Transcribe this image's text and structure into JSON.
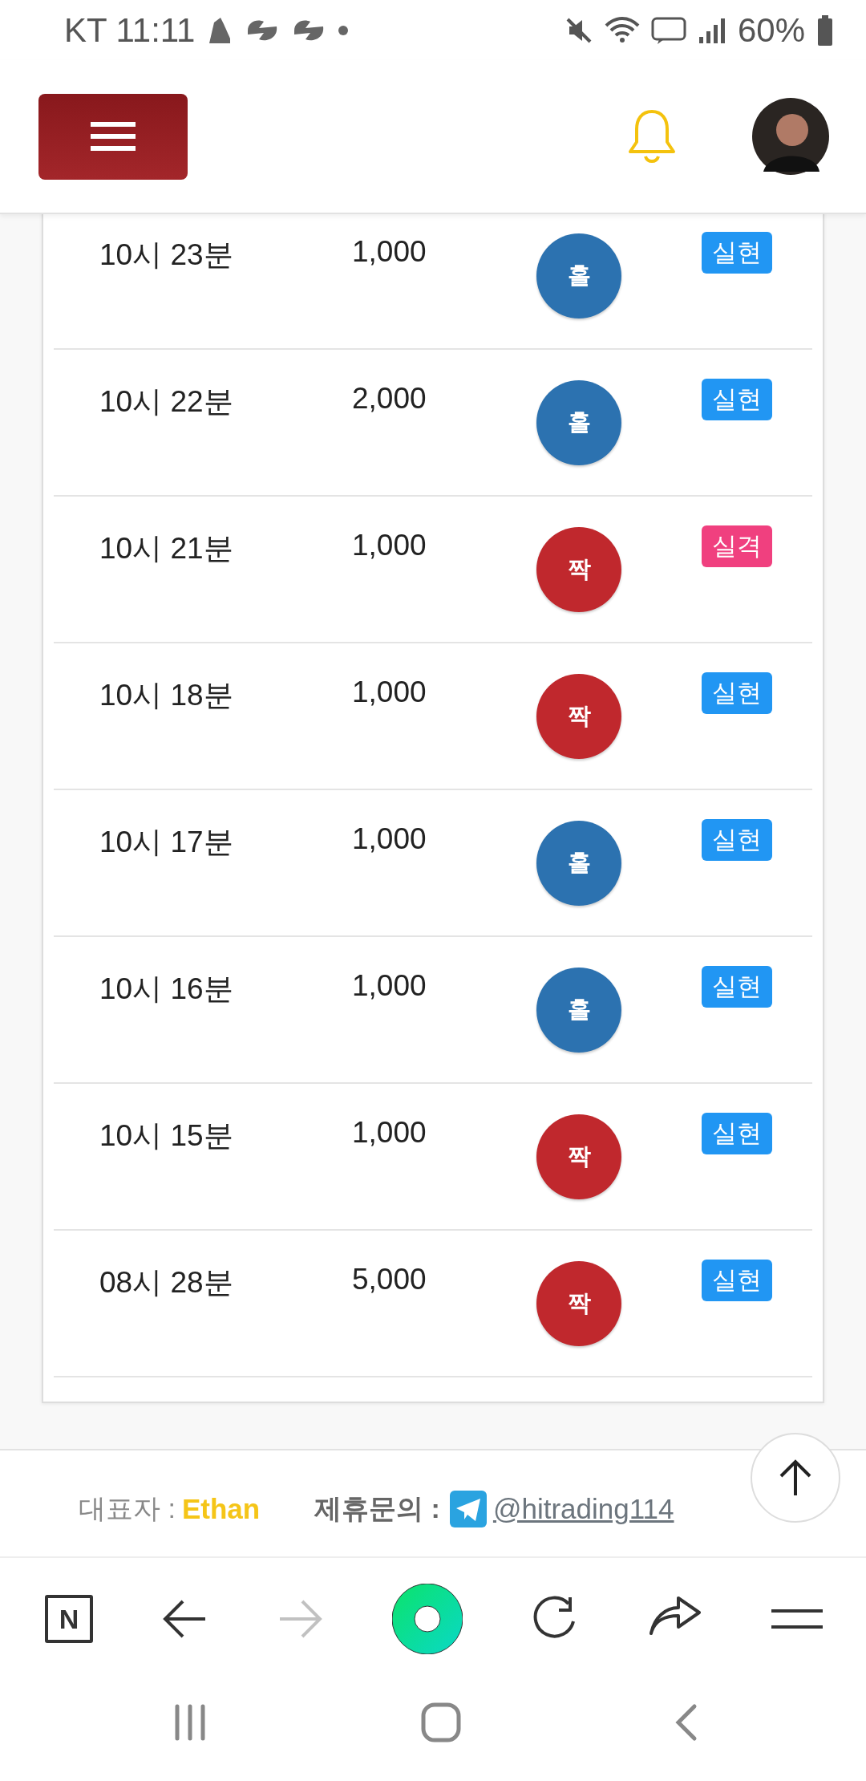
{
  "status_bar": {
    "carrier_time": "KT 11:11",
    "battery": "60%"
  },
  "rows": [
    {
      "time": "10시 23분",
      "amount": "1,000",
      "pick": {
        "label": "홀",
        "kind": "odd"
      },
      "result": {
        "label": "실현",
        "kind": "hit"
      }
    },
    {
      "time": "10시 22분",
      "amount": "2,000",
      "pick": {
        "label": "홀",
        "kind": "odd"
      },
      "result": {
        "label": "실현",
        "kind": "hit"
      }
    },
    {
      "time": "10시 21분",
      "amount": "1,000",
      "pick": {
        "label": "짝",
        "kind": "even"
      },
      "result": {
        "label": "실격",
        "kind": "miss"
      }
    },
    {
      "time": "10시 18분",
      "amount": "1,000",
      "pick": {
        "label": "짝",
        "kind": "even"
      },
      "result": {
        "label": "실현",
        "kind": "hit"
      }
    },
    {
      "time": "10시 17분",
      "amount": "1,000",
      "pick": {
        "label": "홀",
        "kind": "odd"
      },
      "result": {
        "label": "실현",
        "kind": "hit"
      }
    },
    {
      "time": "10시 16분",
      "amount": "1,000",
      "pick": {
        "label": "홀",
        "kind": "odd"
      },
      "result": {
        "label": "실현",
        "kind": "hit"
      }
    },
    {
      "time": "10시 15분",
      "amount": "1,000",
      "pick": {
        "label": "짝",
        "kind": "even"
      },
      "result": {
        "label": "실현",
        "kind": "hit"
      }
    },
    {
      "time": "08시 28분",
      "amount": "5,000",
      "pick": {
        "label": "짝",
        "kind": "even"
      },
      "result": {
        "label": "실현",
        "kind": "hit"
      }
    }
  ],
  "footer": {
    "owner_label": "대표자 :",
    "owner_name": "Ethan",
    "contact_label": "제휴문의 :",
    "contact_link": "@hitrading114"
  },
  "browser_bar": {
    "logo": "N",
    "buttons": [
      {
        "kind": "back",
        "disabled": false
      },
      {
        "kind": "forward",
        "disabled": true
      },
      {
        "kind": "home",
        "disabled": false
      },
      {
        "kind": "reload",
        "disabled": false
      },
      {
        "kind": "share",
        "disabled": false
      },
      {
        "kind": "menu",
        "disabled": false
      }
    ]
  }
}
